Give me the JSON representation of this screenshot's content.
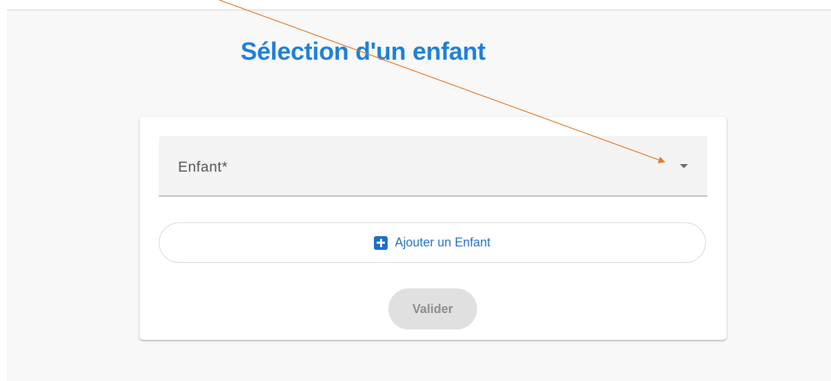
{
  "page": {
    "title": "Sélection d'un enfant"
  },
  "form": {
    "child_select": {
      "label": "Enfant*",
      "value": ""
    },
    "add_child_button": {
      "label": "Ajouter un Enfant",
      "icon": "plus-square-icon"
    },
    "validate_button": {
      "label": "Valider",
      "disabled": true
    }
  },
  "colors": {
    "title": "#1e7fd8",
    "accent": "#1e6fc9",
    "annotation_arrow": "#e07b2b",
    "disabled_button_bg": "#e0e0e0"
  }
}
